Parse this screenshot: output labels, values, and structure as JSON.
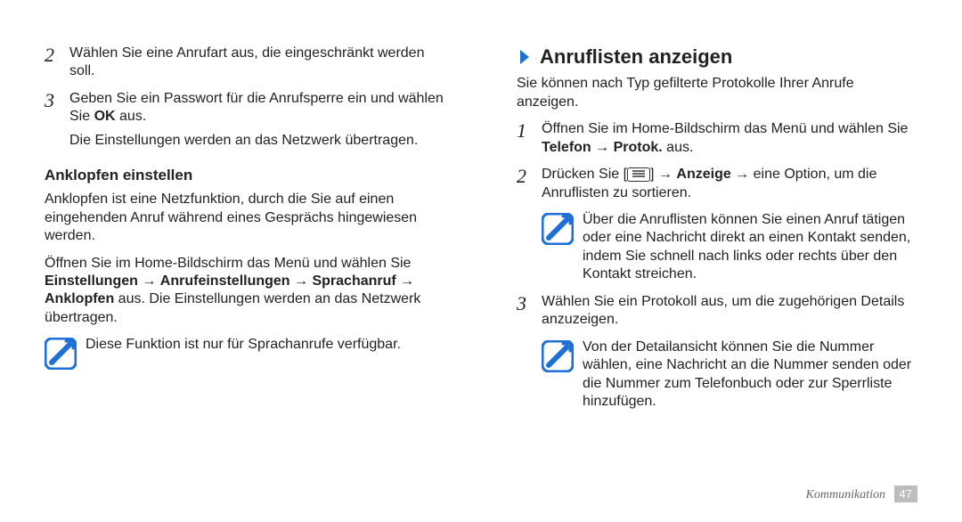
{
  "left": {
    "step2_num": "2",
    "step2": "Wählen Sie eine Anrufart aus, die eingeschränkt werden soll.",
    "step3_num": "3",
    "step3_a": "Geben Sie ein Passwort für die Anrufsperre ein und wählen Sie ",
    "step3_ok": "OK",
    "step3_b": " aus.",
    "step3_sub": "Die Einstellungen werden an das Netzwerk übertragen.",
    "subhead": "Anklopfen einstellen",
    "para1": "Anklopfen ist eine Netzfunktion, durch die Sie auf einen eingehenden Anruf während eines Gesprächs hingewiesen werden.",
    "para2_a": "Öffnen Sie im Home-Bildschirm das Menü und wählen Sie ",
    "para2_b": "Einstellungen",
    "arrow": " → ",
    "para2_c": "Anrufeinstellungen",
    "para2_d": "Sprachanruf",
    "para2_e": "Anklopfen",
    "para2_f": " aus. Die Einstellungen werden an das Netzwerk übertragen.",
    "note": "Diese Funktion ist nur für Sprachanrufe verfügbar."
  },
  "right": {
    "section_title": "Anruflisten anzeigen",
    "intro": "Sie können nach Typ gefilterte Protokolle Ihrer Anrufe anzeigen.",
    "step1_num": "1",
    "step1_a": "Öffnen Sie im Home-Bildschirm das Menü und wählen Sie ",
    "step1_b": "Telefon",
    "step1_c": "Protok.",
    "step1_d": " aus.",
    "step2_num": "2",
    "step2_a": "Drücken Sie [",
    "step2_b": "] → ",
    "step2_c": "Anzeige",
    "step2_d": " → eine Option, um die Anruflisten zu sortieren.",
    "note1": "Über die Anruflisten können Sie einen Anruf tätigen oder eine Nachricht direkt an einen Kontakt senden, indem Sie schnell nach links oder rechts über den Kontakt streichen.",
    "step3_num": "3",
    "step3": "Wählen Sie ein Protokoll aus, um die zugehörigen Details anzuzeigen.",
    "note2": "Von der Detailansicht können Sie die Nummer wählen, eine Nachricht an die Nummer senden oder die Nummer zum Telefonbuch oder zur Sperrliste hinzufügen."
  },
  "footer": {
    "label": "Kommunikation",
    "page": "47"
  }
}
